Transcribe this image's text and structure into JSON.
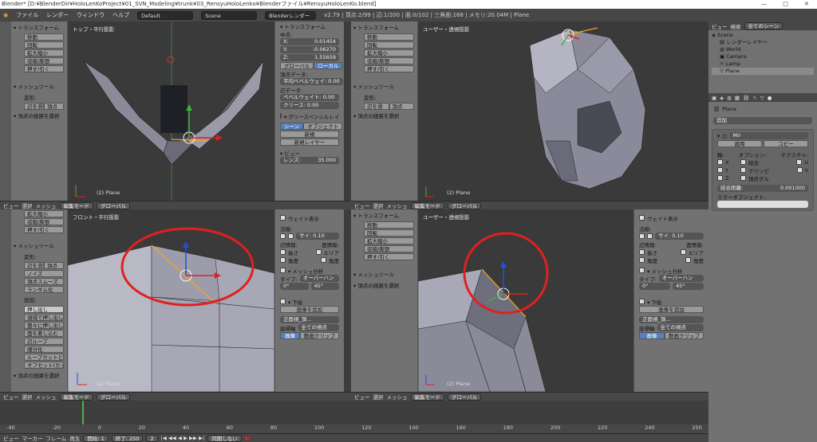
{
  "window": {
    "title": "Blender* [D:¥BlenderDir¥HoloLenKoProject¥01_SVN_Modeling¥trunk¥03_RensyuHoloLenko¥Blenderファイル¥RensyuHoloLenKo.blend]",
    "minimize": "—",
    "maximize": "□",
    "close": "✕"
  },
  "menubar": {
    "items": [
      "ファイル",
      "レンダー",
      "ウィンドウ",
      "ヘルプ"
    ],
    "layout": "Default",
    "scene": "Scene",
    "engine": "Blenderレンダー",
    "stats": "v2.79 | 頂点:2/99 | 辺:1/200 | 面:0/102 | 三角面:168 | メモリ:20.04M | Plane"
  },
  "toolshelf_tl": {
    "section1": "▾ トランスフォーム",
    "buttons": [
      "移動",
      "回転",
      "拡大縮小",
      "収縮/膨張",
      "押す/引く"
    ],
    "section2": "▾ メッシュツール",
    "deform": "変形:",
    "deform_buttons": [
      "辺を滑",
      "頂点"
    ],
    "op": "▾ 頂点の経路を選択"
  },
  "viewports": {
    "top_left": {
      "label": "トップ・平行投影",
      "object": "(2) Plane"
    },
    "top_right": {
      "label": "ユーザー・透視投影",
      "object": "(2) Plane"
    },
    "bottom_left": {
      "label": "フロント・平行投影",
      "object": "(2) Plane"
    },
    "bottom_right": {
      "label": "ユーザー・透視投影",
      "object": "(2) Plane"
    }
  },
  "npanel_tl": {
    "transform": "▾ トランスフォーム",
    "median": "中点:",
    "x": {
      "label": "X:",
      "value": "0.01454"
    },
    "y": {
      "label": "Y:",
      "value": "-0.06270"
    },
    "z": {
      "label": "Z:",
      "value": "1.55659"
    },
    "global": "グローバル",
    "local": "ローカル",
    "vdata": "頂点データ:",
    "bevel_weight": "平均ベベルウェイ: 0.00",
    "edata": "辺データ:",
    "eb": "ベベルウェイト: 0.00",
    "crease": "クリース: 0.00",
    "gp": "▾ グリースペンシルレイ",
    "scene": "シーン",
    "object": "オブジェクト",
    "new": "新規",
    "new_layer": "新規レイヤー",
    "view": "▾ ビュー",
    "lens": {
      "label": "レンズ:",
      "value": "35.000"
    }
  },
  "toolshelf_tr": {
    "section1": "▾ トランスフォーム",
    "buttons": [
      "移動",
      "回転",
      "拡大縮小",
      "収縮/膨張",
      "押す/引く"
    ],
    "section2": "▾ メッシュツール",
    "deform": "変形:",
    "deform_buttons": [
      "辺を滑",
      "頂点"
    ],
    "op": "▾ 頂点の経路を選択"
  },
  "toolshelf_bl": {
    "buttons": [
      "拡大縮小",
      "収縮/膨張",
      "押す/引く"
    ],
    "section2": "▾ メッシュツール",
    "deform": "変形:",
    "deform_buttons": [
      "辺を滑",
      "頂点"
    ],
    "extra": [
      "ノイズ",
      "頂点スムーズ",
      "ランダム化"
    ],
    "add": "追加:",
    "add_buttons": [
      "押し出し",
      "領域で押し出し",
      "個々に押し出し",
      "面を差し込む",
      "辺ループ",
      "細分化",
      "ループカットと...",
      "オフセット(カット)"
    ],
    "op": "▾ 頂点の経路を選択"
  },
  "npanel_bl": {
    "weight": "ウェイト表示",
    "normal": "法線:",
    "size": "サイ: 0.10",
    "edge_info": "辺情報:",
    "face_info": "面情報:",
    "length": "長さ",
    "area": "エリア",
    "angle1": "角度",
    "angle2": "角度",
    "mesh_analysis": "▾ メッシュ分析",
    "type": "タイプ:",
    "overhang": "オーバーハン",
    "deg0": "0°",
    "deg45": "45°",
    "background": "▾ 下絵",
    "add_image": "画像を追加",
    "front_label": "正面視_頂...",
    "axis": "座標軸",
    "allview": "全ての視点",
    "image": "画像",
    "movie": "動画クリップ"
  },
  "toolshelf_br": {
    "section1": "▾ トランスフォーム",
    "buttons": [
      "移動",
      "回転",
      "拡大縮小",
      "収縮/膨張",
      "押す/引く"
    ],
    "section2": "▾ メッシュツール",
    "op": "▾ 頂点の経路を選択"
  },
  "headerbar": {
    "view": "ビュー",
    "select": "選択",
    "mesh": "メッシュ",
    "mode": "編集モード",
    "orient": "グローバル"
  },
  "outliner": {
    "view": "ビュー",
    "search": "検索",
    "scenes": "全てのシーン",
    "items": [
      "Scene",
      "レンダーレイヤー",
      "World",
      "Camera",
      "Lamp",
      "Plane"
    ]
  },
  "properties": {
    "object": "Plane",
    "add": "追加",
    "modifier": "Mir",
    "apply": "適用",
    "copy": "コピー",
    "axis": "軸:",
    "options": "オプション:",
    "texture": "テクスチャ:",
    "x": "X",
    "y": "Y",
    "z": "Z",
    "merge": "結合",
    "clip": "クリッピ",
    "vgroup": "頂点グル",
    "u": "U",
    "v": "V",
    "merge_dist": {
      "label": "結合距離:",
      "value": "0.001000"
    },
    "mirror_obj": "ミラーオブジェクト:"
  },
  "timeline": {
    "ticks": [
      "-40",
      "-20",
      "0",
      "20",
      "40",
      "60",
      "80",
      "100",
      "120",
      "140",
      "160",
      "180",
      "200",
      "220",
      "240",
      "250"
    ],
    "view": "ビュー",
    "marker": "マーカー",
    "frame": "フレーム",
    "play": "再生",
    "start": "開始:",
    "start_val": "1",
    "end": "終了:",
    "end_val": "250",
    "current": "2",
    "sync": "同期しない"
  },
  "colors": {
    "selection": "#f5a623",
    "annotation": "#e02020",
    "active_blue": "#5680c2"
  }
}
